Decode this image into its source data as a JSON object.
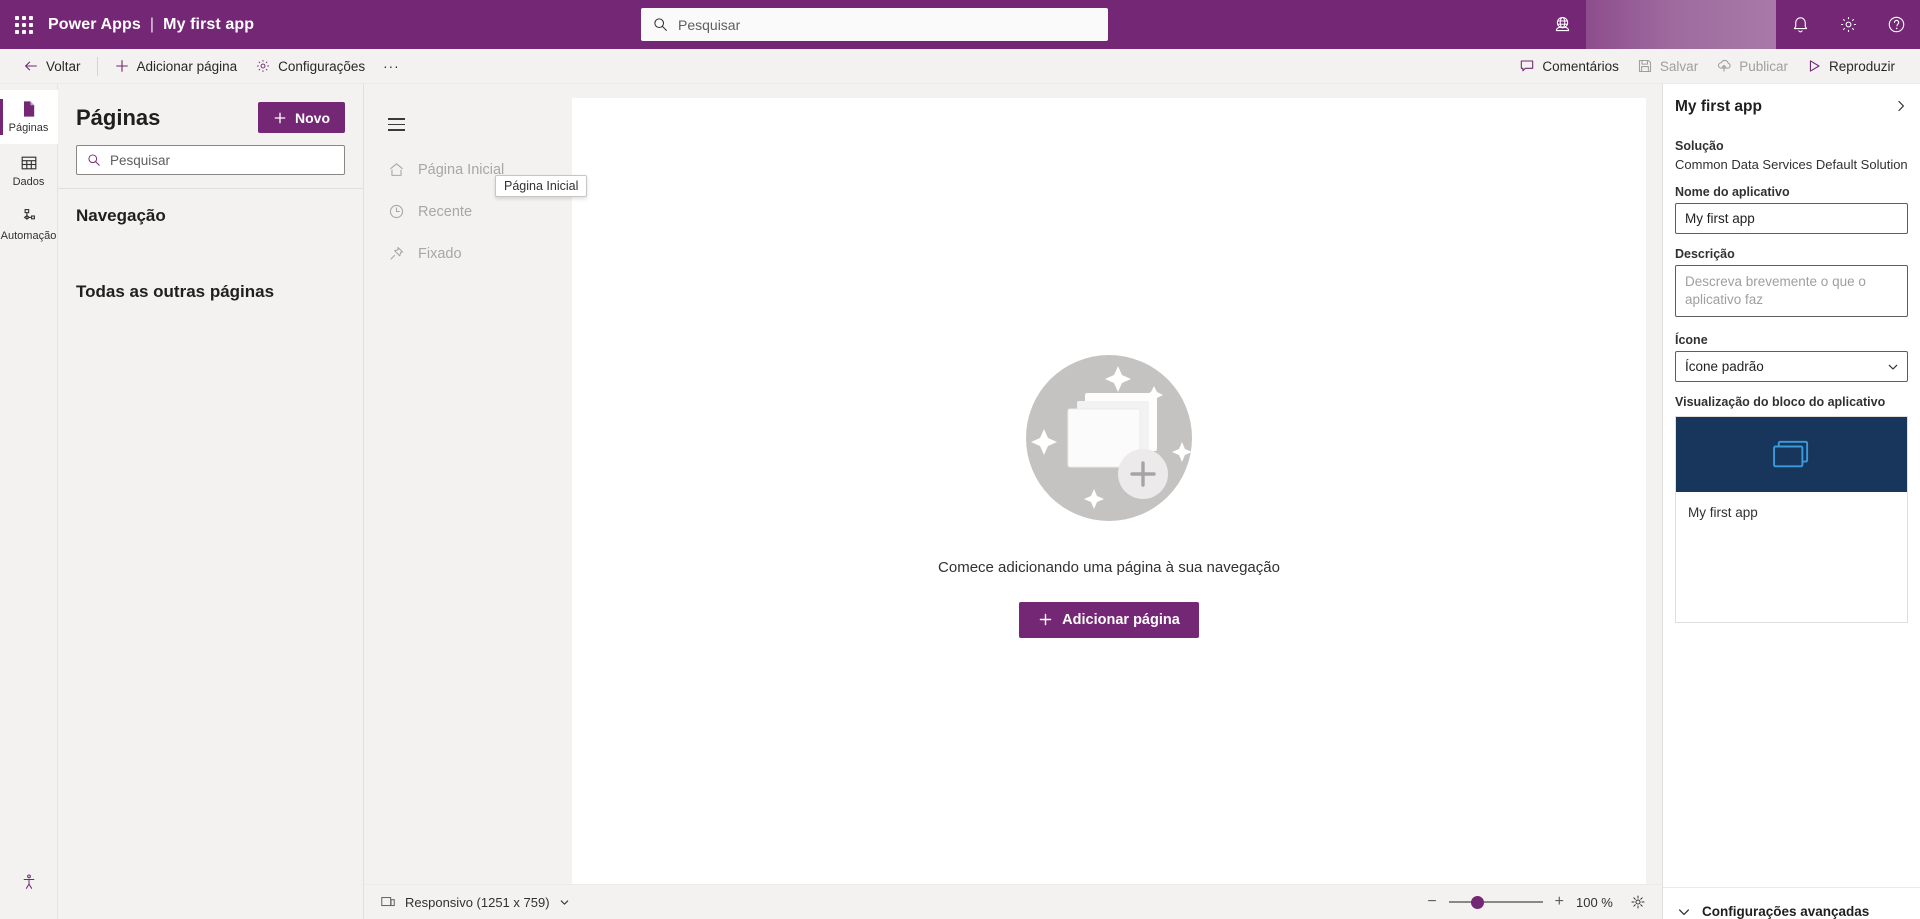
{
  "header": {
    "waffle_label": "waffle-menu",
    "product": "Power Apps",
    "separator": "|",
    "app_name": "My first app",
    "search_placeholder": "Pesquisar",
    "icons": {
      "environment": "environment-globe-icon",
      "notification": "bell-icon",
      "settings": "gear-icon",
      "help": "help-icon"
    }
  },
  "commandbar": {
    "back": "Voltar",
    "add_page": "Adicionar página",
    "settings": "Configurações",
    "overflow": "···",
    "comments": "Comentários",
    "save": "Salvar",
    "publish": "Publicar",
    "play": "Reproduzir"
  },
  "rail": {
    "items": [
      {
        "label": "Páginas",
        "icon": "page-icon",
        "active": true
      },
      {
        "label": "Dados",
        "icon": "table-icon",
        "active": false
      },
      {
        "label": "Automação",
        "icon": "flow-icon",
        "active": false
      }
    ],
    "bottom_icon": "accessibility-checker-icon"
  },
  "pages_panel": {
    "title": "Páginas",
    "new_button": "Novo",
    "search_placeholder": "Pesquisar",
    "navigation_heading": "Navegação",
    "other_pages_heading": "Todas as outras páginas"
  },
  "app_nav": {
    "hamburger": "hamburger-icon",
    "items": [
      {
        "label": "Página Inicial",
        "icon": "home-icon"
      },
      {
        "label": "Recente",
        "icon": "clock-icon"
      },
      {
        "label": "Fixado",
        "icon": "pin-icon"
      }
    ],
    "tooltip": "Página Inicial"
  },
  "canvas": {
    "empty_message": "Comece adicionando uma página à sua navegação",
    "add_page_button": "Adicionar página"
  },
  "statusbar": {
    "responsive_label": "Responsivo (1251 x 759)",
    "zoom_out": "−",
    "zoom_in": "+",
    "zoom_value": "100 %",
    "fit_icon": "fit-to-screen-icon",
    "slider_percent": 25
  },
  "properties": {
    "title": "My first app",
    "collapse_icon": "chevron-right-icon",
    "solution_label": "Solução",
    "solution_value": "Common Data Services Default Solution",
    "app_name_label": "Nome do aplicativo",
    "app_name_value": "My first app",
    "description_label": "Descrição",
    "description_placeholder": "Descreva brevemente o que o aplicativo faz",
    "icon_label": "Ícone",
    "icon_value": "Ícone padrão",
    "tile_preview_label": "Visualização do bloco do aplicativo",
    "tile_title": "My first app",
    "advanced_settings": "Configurações avançadas"
  },
  "colors": {
    "brand_purple": "#742774",
    "header_purple": "#742774",
    "tile_navy": "#18365c",
    "tile_icon_blue": "#3a9bdc",
    "panel_bg": "#f3f2f1"
  }
}
